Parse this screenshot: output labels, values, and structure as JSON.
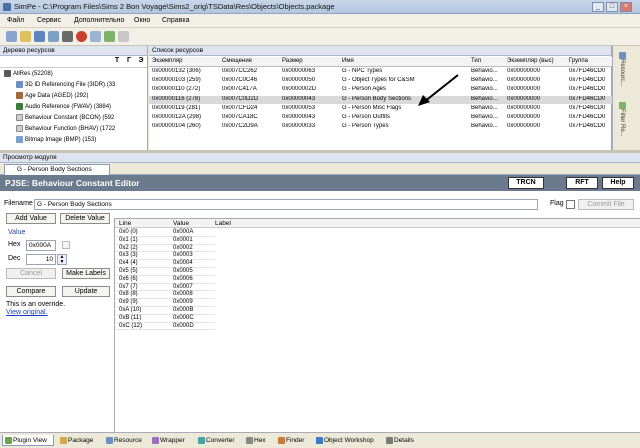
{
  "window": {
    "title": "SimPe - C:\\Program Files\\Sims 2 Bon Voyage\\Sims2_orig\\TSData\\Res\\Objects\\Objects.package"
  },
  "menu": [
    "Файл",
    "Сервис",
    "Дополнительно",
    "Окно",
    "Справка"
  ],
  "tree": {
    "header": "Дерево ресурсов",
    "tools": [
      "T",
      "Г",
      "Э"
    ],
    "items": [
      "AllRes (52208)",
      "3D ID Referencing File (3IDR) (33",
      "Age Data (AGED) (292)",
      "Audio Reference (FWAV) (3884)",
      "Behaviour Constant (BCON) (592",
      "Behaviour Function (BHAV) (1722",
      "Bitmap Image (BMP) (153)"
    ]
  },
  "reslist": {
    "header": "Список ресурсов",
    "columns": [
      "Экземпляр",
      "Смещение",
      "Размер",
      "Имя",
      "Тип",
      "Экземпляр (выс)",
      "Группа"
    ],
    "rows": [
      [
        "0x00000132 (306)",
        "0x007CC262",
        "0x00000063",
        "G - NPC Types",
        "Behavio...",
        "0x00000000",
        "0x7FD46CD0"
      ],
      [
        "0x00000103 (259)",
        "0x007C0C46",
        "0x00000050",
        "G - Object Types for C&SM",
        "Behavio...",
        "0x00000000",
        "0x7FD46CD0"
      ],
      [
        "0x00000110 (272)",
        "0x007C417A",
        "0x0000002D",
        "G - Person Ages",
        "Behavio...",
        "0x00000000",
        "0x7FD46CD0"
      ],
      [
        "0x00000116 (278)",
        "0x007C0D2D",
        "0x00000043",
        "G - Person Body Sections",
        "Behavio...",
        "0x00000000",
        "0x7FD46CD0"
      ],
      [
        "0x00000119 (281)",
        "0x007CFD24",
        "0x00000053",
        "G - Person Misc Flags",
        "Behavio...",
        "0x00000000",
        "0x7FD46CD0"
      ],
      [
        "0x0000012A (298)",
        "0x007CA18C",
        "0x00000043",
        "G - Person Outfits",
        "Behavio...",
        "0x00000000",
        "0x7FD46CD0"
      ],
      [
        "0x00000104 (260)",
        "0x007C2D9A",
        "0x00000033",
        "G - Person Types",
        "Behavio...",
        "0x00000000",
        "0x7FD46CD0"
      ]
    ]
  },
  "side_tabs": [
    "Resourc...",
    "Filter Re..."
  ],
  "plugin_view": {
    "header": "Просмотр модуля",
    "tab": "G - Person Body Sections"
  },
  "pjse": {
    "title": "PJSE: Behaviour Constant Editor",
    "btn_trcn": "TRCN",
    "btn_rft": "RFT",
    "btn_help": "Help",
    "filename_label": "Filename",
    "filename_value": "G - Person Body Sections",
    "flag_label": "Flag",
    "commit_label": "Commit File",
    "add_value": "Add Value",
    "delete_value": "Delete Value",
    "value_section": "Value",
    "hex_label": "Hex",
    "hex_value": "0x000A",
    "dec_label": "Dec",
    "dec_value": "10",
    "cancel_label": "Cancel",
    "make_labels": "Make Labels",
    "compare_label": "Compare",
    "update_label": "Update",
    "override_text": "This is an override.",
    "view_original": "View original.",
    "grid_columns": [
      "Line",
      "Value",
      "Label"
    ],
    "grid_rows": [
      [
        "0x0 (0)",
        "0x000A"
      ],
      [
        "0x1 (1)",
        "0x0001"
      ],
      [
        "0x2 (2)",
        "0x0002"
      ],
      [
        "0x3 (3)",
        "0x0003"
      ],
      [
        "0x4 (4)",
        "0x0004"
      ],
      [
        "0x5 (5)",
        "0x0005"
      ],
      [
        "0x6 (6)",
        "0x0006"
      ],
      [
        "0x7 (7)",
        "0x0007"
      ],
      [
        "0x8 (8)",
        "0x0008"
      ],
      [
        "0x9 (9)",
        "0x0009"
      ],
      [
        "0xA (10)",
        "0x000B"
      ],
      [
        "0xB (11)",
        "0x000C"
      ],
      [
        "0xC (12)",
        "0x000D"
      ]
    ]
  },
  "bottom_tabs": [
    "Plugin View",
    "Package",
    "Resource",
    "Wrapper",
    "Converter",
    "Hex",
    "Finder",
    "Object Workshop",
    "Details"
  ]
}
